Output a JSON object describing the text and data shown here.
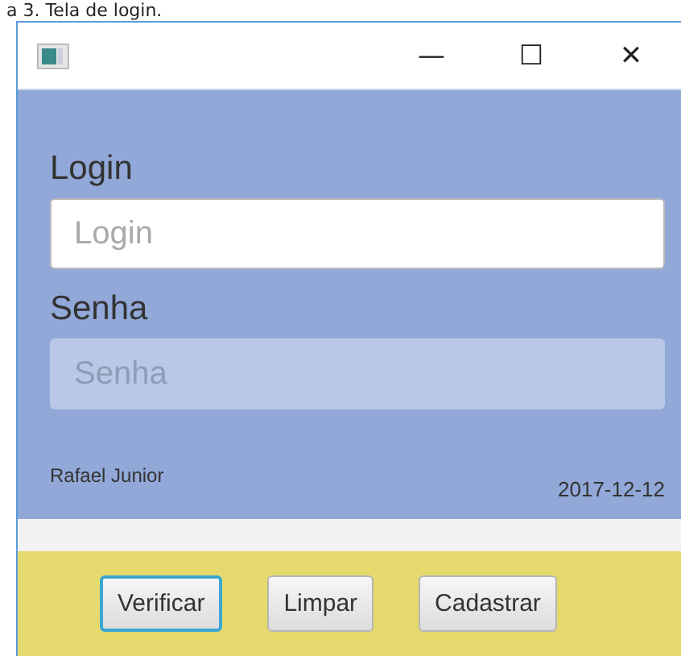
{
  "caption": "a 3. Tela de login.",
  "window": {
    "title_controls": [
      "—",
      "☐",
      "✕"
    ]
  },
  "fields": [
    {
      "label": "Login",
      "placeholder": "Login",
      "disabled": false
    },
    {
      "label": "Senha",
      "placeholder": "Senha",
      "disabled": true
    }
  ],
  "footer": {
    "author": "Rafael Junior",
    "date": "2017-12-12"
  },
  "buttons": [
    {
      "label": "Verificar",
      "focused": true
    },
    {
      "label": "Limpar",
      "focused": false
    },
    {
      "label": "Cadastrar",
      "focused": false
    }
  ]
}
